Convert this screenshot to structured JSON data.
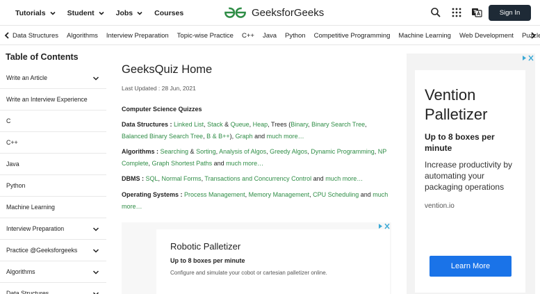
{
  "header": {
    "nav": [
      {
        "label": "Tutorials"
      },
      {
        "label": "Student"
      },
      {
        "label": "Jobs"
      },
      {
        "label": "Courses"
      }
    ],
    "logo_text": "GeeksforGeeks",
    "signin_label": "Sign In",
    "icons": [
      "search-icon",
      "apps-grid-icon",
      "translate-icon"
    ],
    "colors": {
      "brand_green": "#2f8d46",
      "signin_bg": "#1e2a36"
    }
  },
  "categories": [
    "Data Structures",
    "Algorithms",
    "Interview Preparation",
    "Topic-wise Practice",
    "C++",
    "Java",
    "Python",
    "Competitive Programming",
    "Machine Learning",
    "Web Development",
    "Puzzles"
  ],
  "sidebar": {
    "title": "Table of Contents",
    "items": [
      {
        "label": "Write an Article",
        "expandable": true
      },
      {
        "label": "Write an Interview Experience",
        "expandable": false
      },
      {
        "label": "C",
        "expandable": false
      },
      {
        "label": "C++",
        "expandable": false
      },
      {
        "label": "Java",
        "expandable": false
      },
      {
        "label": "Python",
        "expandable": false
      },
      {
        "label": "Machine Learning",
        "expandable": false
      },
      {
        "label": "Interview Preparation",
        "expandable": true
      },
      {
        "label": "Practice @Geeksforgeeks",
        "expandable": true
      },
      {
        "label": "Algorithms",
        "expandable": true
      },
      {
        "label": "Data Structures",
        "expandable": true
      }
    ]
  },
  "article": {
    "title": "GeeksQuiz Home",
    "updated": "Last Updated : 28 Jun, 2021",
    "heading": "Computer Science Quizzes",
    "sections": [
      {
        "label": "Data Structures :",
        "parts": [
          {
            "t": " "
          },
          {
            "t": "Linked List",
            "link": true
          },
          {
            "t": ", "
          },
          {
            "t": "Stack",
            "link": true
          },
          {
            "t": " & "
          },
          {
            "t": "Queue",
            "link": true
          },
          {
            "t": ", "
          },
          {
            "t": "Heap",
            "link": true
          },
          {
            "t": ", Trees ("
          },
          {
            "t": "Binary",
            "link": true
          },
          {
            "t": ", "
          },
          {
            "t": "Binary Search Tree",
            "link": true
          },
          {
            "t": ", "
          },
          {
            "t": "Balanced Binary Search Tree",
            "link": true
          },
          {
            "t": ", "
          },
          {
            "t": "B & B++",
            "link": true
          },
          {
            "t": "), "
          },
          {
            "t": "Graph",
            "link": true
          },
          {
            "t": " and "
          },
          {
            "t": "much more…",
            "link": true
          }
        ]
      },
      {
        "label": "Algorithms :",
        "parts": [
          {
            "t": " "
          },
          {
            "t": "Searching",
            "link": true
          },
          {
            "t": " & "
          },
          {
            "t": "Sorting",
            "link": true
          },
          {
            "t": ", "
          },
          {
            "t": "Analysis of Algos",
            "link": true
          },
          {
            "t": ", "
          },
          {
            "t": "Greedy Algos",
            "link": true
          },
          {
            "t": ", "
          },
          {
            "t": "Dynamic Programming",
            "link": true
          },
          {
            "t": ", "
          },
          {
            "t": "NP Complete",
            "link": true
          },
          {
            "t": ", "
          },
          {
            "t": "Graph Shortest Paths",
            "link": true
          },
          {
            "t": " and "
          },
          {
            "t": "much more…",
            "link": true
          }
        ]
      },
      {
        "label": "DBMS :",
        "parts": [
          {
            "t": " "
          },
          {
            "t": "SQL",
            "link": true
          },
          {
            "t": ", "
          },
          {
            "t": "Normal Forms",
            "link": true
          },
          {
            "t": ", "
          },
          {
            "t": "Transactions and Concurrency Control",
            "link": true
          },
          {
            "t": " and "
          },
          {
            "t": "much more…",
            "link": true
          }
        ]
      },
      {
        "label": "Operating Systems :",
        "parts": [
          {
            "t": " "
          },
          {
            "t": "Process Management",
            "link": true
          },
          {
            "t": ", "
          },
          {
            "t": "Memory Management",
            "link": true
          },
          {
            "t": ", "
          },
          {
            "t": "CPU Scheduling",
            "link": true
          },
          {
            "t": " and "
          },
          {
            "t": "much more…",
            "link": true
          }
        ]
      }
    ]
  },
  "inline_ad": {
    "title": "Robotic Palletizer",
    "subtitle": "Up to 8 boxes per minute",
    "description": "Configure and simulate your cobot or cartesian palletizer online."
  },
  "side_ad": {
    "title": "Vention Palletizer",
    "subtitle": "Up to 8 boxes per minute",
    "description": "Increase productivity by automating your packaging operations",
    "domain": "vention.io",
    "button": "Learn More",
    "button_color": "#1a73e8"
  }
}
